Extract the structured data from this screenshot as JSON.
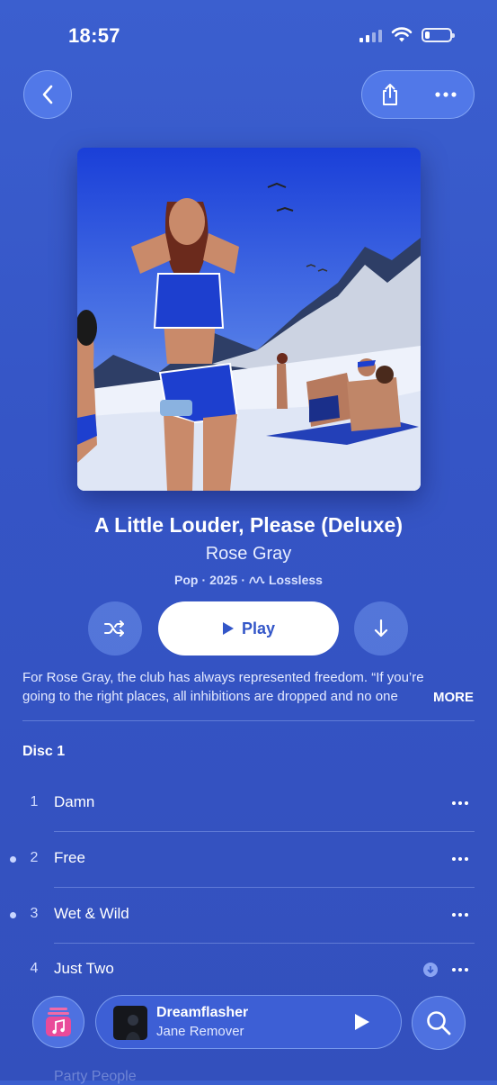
{
  "status_bar": {
    "time": "18:57"
  },
  "album": {
    "title": "A Little Louder, Please (Deluxe)",
    "artist": "Rose Gray",
    "genre": "Pop",
    "year": "2025",
    "quality": "Lossless",
    "separator": "·"
  },
  "controls": {
    "play_label": "Play"
  },
  "description": {
    "text": "For Rose Gray, the club has always represented freedom. “If you’re going to the right places, all inhibitions are dropped and no one",
    "more_label": "MORE"
  },
  "disc_label": "Disc 1",
  "tracks": [
    {
      "number": "1",
      "title": "Damn"
    },
    {
      "number": "2",
      "title": "Free"
    },
    {
      "number": "3",
      "title": "Wet & Wild"
    },
    {
      "number": "4",
      "title": "Just Two"
    }
  ],
  "peek_track": "Party People",
  "mini_player": {
    "title": "Dreamflasher",
    "artist": "Jane Remover"
  },
  "colors": {
    "background": "#3a5bcb",
    "accent": "#3356c8"
  },
  "icons": [
    "back-icon",
    "share-icon",
    "more-icon",
    "shuffle-icon",
    "play-icon",
    "download-icon",
    "lossless-icon",
    "music-library-icon",
    "search-icon"
  ]
}
